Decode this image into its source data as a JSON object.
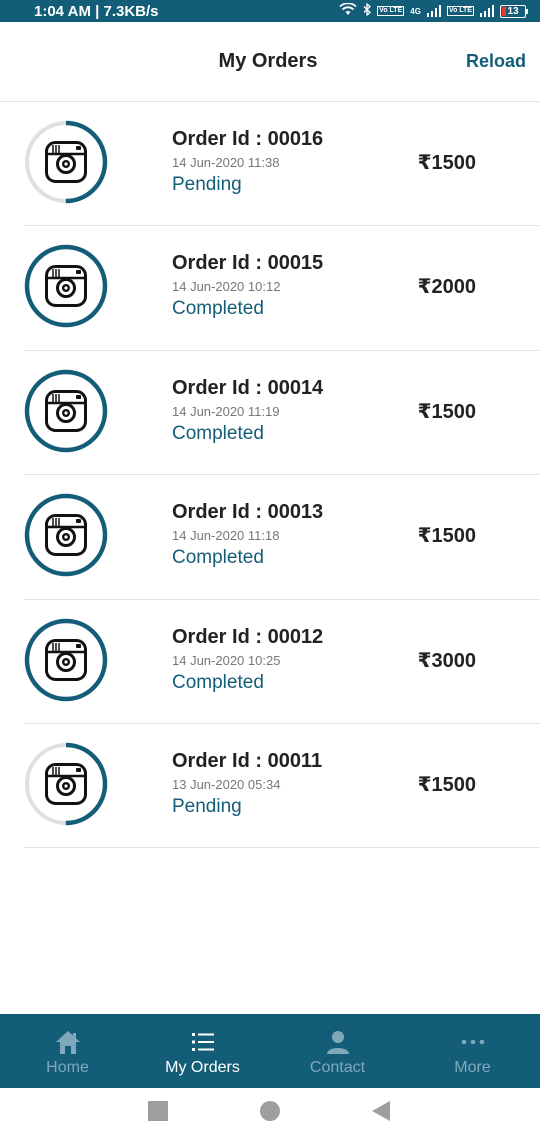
{
  "status_bar": {
    "time_speed": "1:04 AM | 7.3KB/s",
    "network": "4G",
    "lte_badge": "Vo LTE",
    "battery": "13"
  },
  "header": {
    "title": "My Orders",
    "reload_label": "Reload"
  },
  "orders": [
    {
      "id": "Order Id : 00016",
      "date": "14 Jun-2020 11:38",
      "status": "Pending",
      "amount": "₹1500",
      "ring_progress": 0.5
    },
    {
      "id": "Order Id : 00015",
      "date": "14 Jun-2020 10:12",
      "status": "Completed",
      "amount": "₹2000",
      "ring_progress": 1
    },
    {
      "id": "Order Id : 00014",
      "date": "14 Jun-2020 11:19",
      "status": "Completed",
      "amount": "₹1500",
      "ring_progress": 1
    },
    {
      "id": "Order Id : 00013",
      "date": "14 Jun-2020 11:18",
      "status": "Completed",
      "amount": "₹1500",
      "ring_progress": 1
    },
    {
      "id": "Order Id : 00012",
      "date": "14 Jun-2020 10:25",
      "status": "Completed",
      "amount": "₹3000",
      "ring_progress": 1
    },
    {
      "id": "Order Id : 00011",
      "date": "13 Jun-2020 05:34",
      "status": "Pending",
      "amount": "₹1500",
      "ring_progress": 0.5
    }
  ],
  "bottom_nav": [
    {
      "label": "Home",
      "icon": "home-icon",
      "active": false
    },
    {
      "label": "My Orders",
      "icon": "list-icon",
      "active": true
    },
    {
      "label": "Contact",
      "icon": "person-icon",
      "active": false
    },
    {
      "label": "More",
      "icon": "more-dots-icon",
      "active": false
    }
  ],
  "colors": {
    "accent": "#145d78",
    "ring_track": "#e0e0e0",
    "divider": "#e2e2e2"
  }
}
